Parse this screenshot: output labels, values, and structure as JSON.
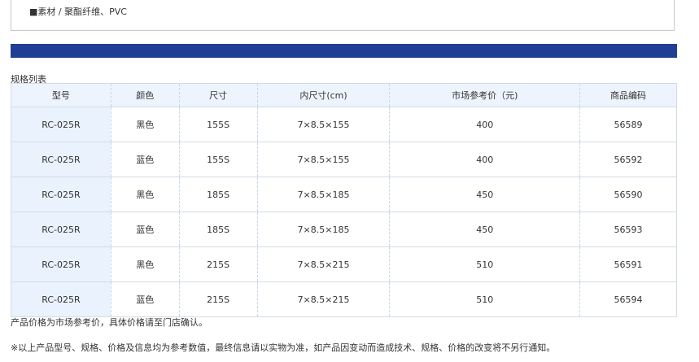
{
  "material_text": "■素材 / 聚酯纤维、PVC",
  "table_caption": "规格列表",
  "headers": [
    "型号",
    "颜色",
    "尺寸",
    "内尺寸(cm)",
    "市场参考价（元)",
    "商品编码"
  ],
  "rows": [
    [
      "RC-025R",
      "黑色",
      "155S",
      "7×8.5×155",
      "400",
      "56589"
    ],
    [
      "RC-025R",
      "蓝色",
      "155S",
      "7×8.5×155",
      "400",
      "56592"
    ],
    [
      "RC-025R",
      "黑色",
      "185S",
      "7×8.5×185",
      "450",
      "56590"
    ],
    [
      "RC-025R",
      "蓝色",
      "185S",
      "7×8.5×185",
      "450",
      "56593"
    ],
    [
      "RC-025R",
      "黑色",
      "215S",
      "7×8.5×215",
      "510",
      "56591"
    ],
    [
      "RC-025R",
      "蓝色",
      "215S",
      "7×8.5×215",
      "510",
      "56594"
    ]
  ],
  "note_price": "产品价格为市场参考价，具体价格请至门店确认。",
  "note_disclaimer": "※以上产品型号、规格、价格及信息均为参考数值，最终信息请以实物为准，如产品因变动而造成技术、规格、价格的改变将不另行通知。",
  "colors": {
    "accent_bar": "#1f3f95",
    "header_bg": "#edf4fd",
    "model_col_bg": "#eaf2fd"
  }
}
